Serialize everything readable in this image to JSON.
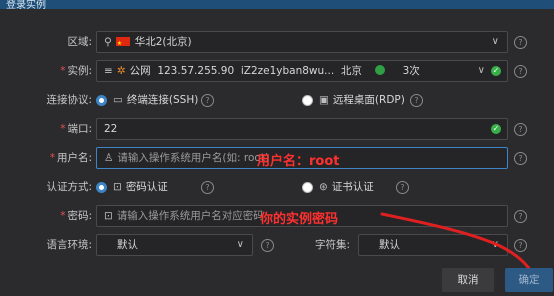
{
  "window": {
    "title": "登录实例"
  },
  "form": {
    "region": {
      "label": "区域:",
      "value": "华北2(北京)"
    },
    "instance": {
      "label": "实例:",
      "network": "公网",
      "ip": "123.57.255.90",
      "name": "iZ2ze1yban8wu...",
      "city": "北京",
      "count": "3次"
    },
    "protocol": {
      "label": "连接协议:",
      "options": [
        "终端连接(SSH)",
        "远程桌面(RDP)"
      ],
      "selected": "终端连接(SSH)"
    },
    "port": {
      "label": "端口:",
      "value": "22"
    },
    "username": {
      "label": "用户名:",
      "placeholder": "请输入操作系统用户名(如: root)"
    },
    "auth": {
      "label": "认证方式:",
      "options": [
        "密码认证",
        "证书认证"
      ],
      "selected": "密码认证"
    },
    "password": {
      "label": "密码:",
      "placeholder": "请输入操作系统用户名对应密码"
    },
    "language": {
      "label": "语言环境:",
      "value": "默认"
    },
    "charset": {
      "label": "字符集:",
      "value": "默认"
    }
  },
  "annotations": {
    "username": "用户名：root",
    "password": "你的实例密码"
  },
  "buttons": {
    "cancel": "取消",
    "confirm": "确定"
  },
  "colors": {
    "accent": "#3d85c6",
    "annotation": "#ff3030",
    "ok": "#38b04a"
  }
}
